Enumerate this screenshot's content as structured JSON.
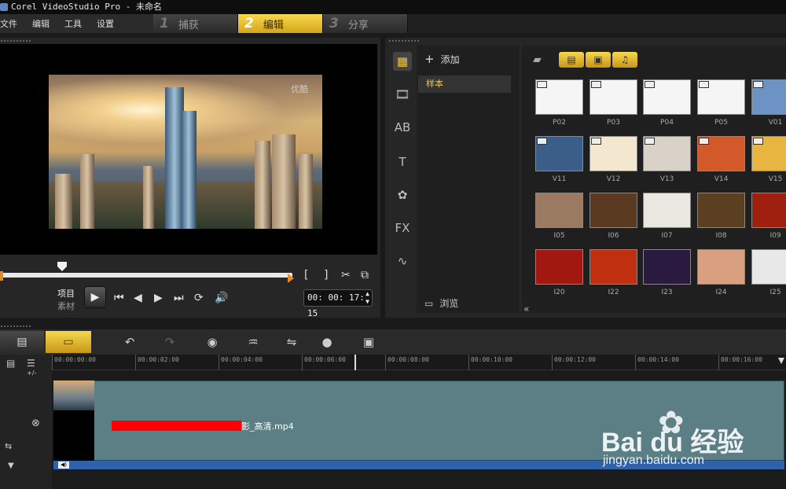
{
  "window": {
    "title": "Corel VideoStudio Pro - 未命名"
  },
  "menu": [
    "文件",
    "编辑",
    "工具",
    "设置"
  ],
  "steps": [
    {
      "num": "1",
      "label": "捕获",
      "active": false
    },
    {
      "num": "2",
      "label": "编辑",
      "active": true
    },
    {
      "num": "3",
      "label": "分享",
      "active": false
    }
  ],
  "preview": {
    "watermark": "优酷",
    "mode_project": "项目",
    "mode_clip": "素材",
    "timecode": "00: 00: 17: 15",
    "controls": {
      "mark_in": "[",
      "mark_out": "]"
    }
  },
  "library": {
    "add_label": "添加",
    "folder_item": "样本",
    "browse_label": "浏览",
    "tabs": [
      "media-icon",
      "transition-icon",
      "title-icon",
      "text-icon",
      "graphic-icon",
      "fx-icon",
      "path-icon"
    ],
    "thumbs": [
      [
        "P02",
        "P03",
        "P04",
        "P05",
        "V01"
      ],
      [
        "V11",
        "V12",
        "V13",
        "V14",
        "V15"
      ],
      [
        "I05",
        "I06",
        "I07",
        "I08",
        "I09"
      ],
      [
        "I20",
        "I22",
        "I23",
        "I24",
        "I25"
      ]
    ]
  },
  "timeline": {
    "ruler": [
      "00:00:00:00",
      "00:00:02:00",
      "00:00:04:00",
      "00:00:06:00",
      "00:00:08:00",
      "00:00:10:00",
      "00:00:12:00",
      "00:00:14:00",
      "00:00:16:00"
    ],
    "clip_name": "影_高清.mp4",
    "track_add_label": "+/-"
  },
  "watermark": {
    "brand": "Bai du 经验",
    "url": "jingyan.baidu.com"
  }
}
